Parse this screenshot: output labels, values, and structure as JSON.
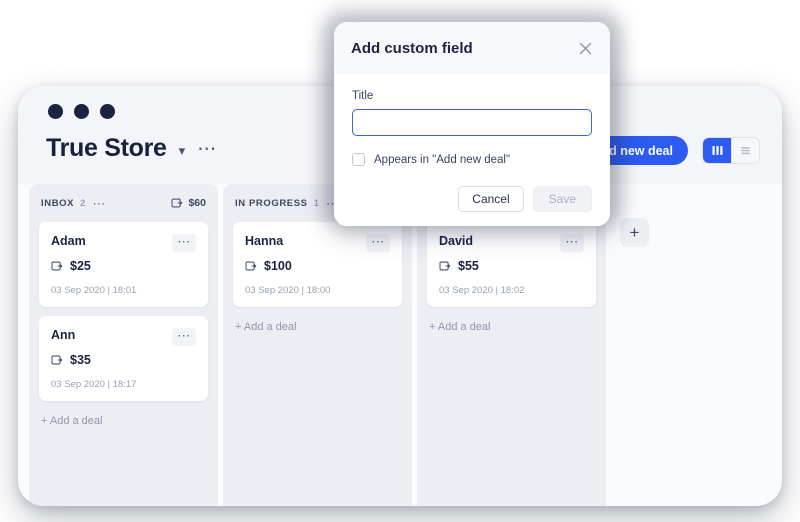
{
  "app": {
    "brand_title": "True Store",
    "chevron_icon": "chevron-down-icon",
    "more_icon": "more-horizontal-icon",
    "add_deal_button": "+ Add new deal",
    "view_board_icon": "board-view-icon",
    "view_list_icon": "list-view-icon",
    "add_column_label": "+"
  },
  "columns": [
    {
      "name": "INBOX",
      "count": "2",
      "sum": "$60",
      "add_deal_label": "+ Add a deal",
      "cards": [
        {
          "name": "Adam",
          "amount": "$25",
          "date": "03 Sep 2020 | 18:01"
        },
        {
          "name": "Ann",
          "amount": "$35",
          "date": "03 Sep 2020 | 18:17"
        }
      ]
    },
    {
      "name": "IN PROGRESS",
      "count": "1",
      "sum": "",
      "add_deal_label": "+ Add a deal",
      "cards": [
        {
          "name": "Hanna",
          "amount": "$100",
          "date": "03 Sep 2020 | 18:00"
        }
      ]
    },
    {
      "name": "",
      "count": "",
      "sum": "",
      "add_deal_label": "+ Add a deal",
      "cards": [
        {
          "name": "David",
          "amount": "$55",
          "date": "03 Sep 2020 | 18:02"
        }
      ]
    }
  ],
  "modal": {
    "title": "Add custom field",
    "close_icon": "close-icon",
    "field_label": "Title",
    "field_value": "",
    "field_placeholder": "",
    "checkbox_label": "Appears in \"Add new deal\"",
    "checkbox_checked": false,
    "cancel_label": "Cancel",
    "save_label": "Save"
  },
  "colors": {
    "accent": "#2d5bf2",
    "input_focus": "#3b63f0",
    "window_bg": "#f4f5f8",
    "column_bg": "#eceef4",
    "text_dark": "#1b2340"
  }
}
